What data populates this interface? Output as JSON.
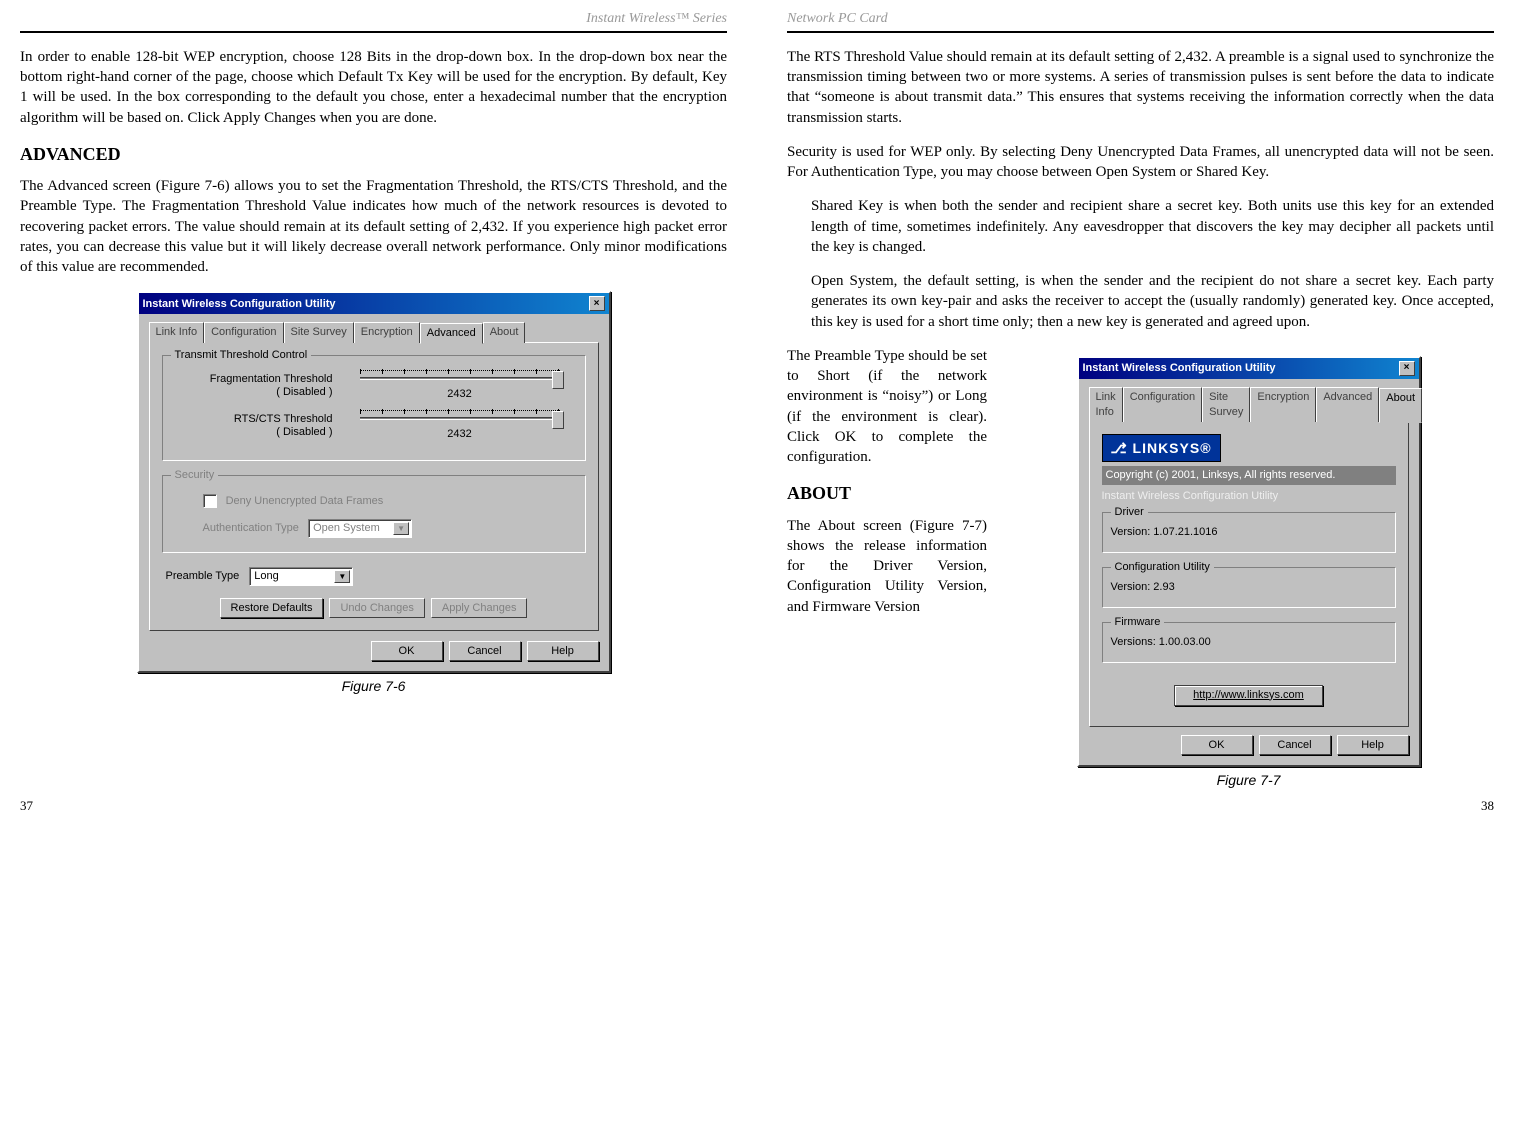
{
  "left": {
    "header": "Instant Wireless™ Series",
    "p1": "In order to enable 128-bit WEP encryption, choose 128 Bits in the drop-down box. In the drop-down box near the bottom right-hand corner of the page, choose which Default Tx Key will be used for the encryption. By default, Key 1 will be used. In the box corresponding to the default you chose, enter a hexadecimal number that the encryption algorithm will be based on. Click Apply Changes when you are done.",
    "h_advanced": "ADVANCED",
    "p2": "The Advanced screen (Figure 7-6) allows you to set the Fragmentation Threshold, the RTS/CTS Threshold, and the Preamble Type. The Fragmentation Threshold Value indicates how much of the network resources is devoted to recovering packet errors. The value should remain at its default setting of 2,432. If you experience high packet error rates, you can decrease this value but it will likely decrease overall network performance. Only minor modifications of this value are recommended.",
    "fig_caption": "Figure 7-6",
    "page_num": "37",
    "dialog": {
      "title": "Instant Wireless Configuration Utility",
      "tabs": [
        "Link Info",
        "Configuration",
        "Site Survey",
        "Encryption",
        "Advanced",
        "About"
      ],
      "group1": "Transmit Threshold Control",
      "frag_label": "Fragmentation Threshold\n( Disabled )",
      "frag_value": "2432",
      "rts_label": "RTS/CTS Threshold\n( Disabled )",
      "rts_value": "2432",
      "group2": "Security",
      "sec_check": "Deny Unencrypted Data Frames",
      "auth_label": "Authentication Type",
      "auth_value": "Open System",
      "preamble_label": "Preamble Type",
      "preamble_value": "Long",
      "btn_restore": "Restore Defaults",
      "btn_undo": "Undo Changes",
      "btn_apply": "Apply Changes",
      "btn_ok": "OK",
      "btn_cancel": "Cancel",
      "btn_help": "Help"
    }
  },
  "right": {
    "header": "Network PC Card",
    "p1": "The RTS Threshold Value should remain at its default setting of 2,432. A preamble is a signal used to synchronize the transmission timing between two or more systems. A series of transmission pulses is sent before the data to indicate that “someone is about transmit data.” This ensures that systems receiving the information correctly when the data transmission starts.",
    "p2": "Security is used for WEP only. By selecting Deny Unencrypted Data Frames, all unencrypted data will not be seen. For Authentication Type, you may choose between Open System or Shared Key.",
    "p3": "Shared Key is when both the sender and recipient share a secret key.  Both units use this key for an extended length of time, sometimes indefinitely. Any eavesdropper that discovers the key may decipher all packets until the key is changed.",
    "p4": "Open System, the default setting, is when the sender and the recipient do not share a secret key. Each party generates its own key-pair and asks the receiver to accept the (usually randomly) generated key.  Once accepted, this key is used for a short time only; then a new key is generated and agreed upon.",
    "p5": "The Preamble Type should be set to Short (if the network environment is “noisy”) or Long (if the environment is clear). Click OK to complete the configuration.",
    "h_about": "ABOUT",
    "p6": "The About screen (Figure 7-7) shows the release information for the Driver Version, Configuration Utility Version, and Firmware Version",
    "fig_caption": "Figure 7-7",
    "page_num": "38",
    "dialog": {
      "title": "Instant Wireless Configuration Utility",
      "tabs": [
        "Link Info",
        "Configuration",
        "Site Survey",
        "Encryption",
        "Advanced",
        "About"
      ],
      "logo": "⎇ LINKSYS®",
      "copyright": "Copyright (c) 2001, Linksys, All rights reserved.",
      "subtitle": "Instant Wireless Configuration Utility",
      "grp_driver": "Driver",
      "driver_line": "Version:   1.07.21.1016",
      "grp_cfg": "Configuration Utility",
      "cfg_line": "Version:   2.93",
      "grp_fw": "Firmware",
      "fw_line": "Versions: 1.00.03.00",
      "link": "http://www.linksys.com",
      "btn_ok": "OK",
      "btn_cancel": "Cancel",
      "btn_help": "Help"
    }
  }
}
